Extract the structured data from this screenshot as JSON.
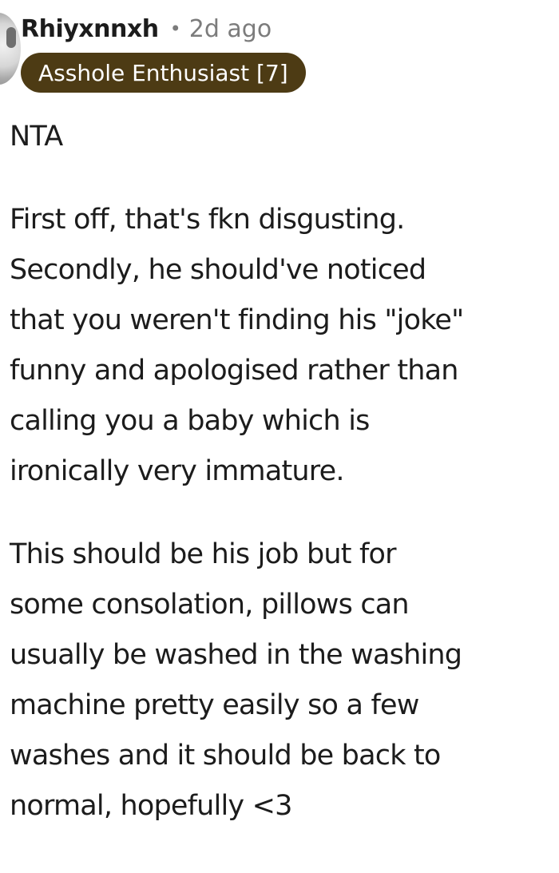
{
  "comment": {
    "author": "Rhiyxnnxh",
    "separator": "•",
    "timestamp": "2d ago",
    "flair": "Asshole Enthusiast [7]",
    "paragraphs": [
      {
        "lines": [
          "NTA"
        ]
      },
      {
        "lines": [
          "First off, that's fkn disgusting.",
          "Secondly, he should've noticed",
          "that you weren't finding his \"joke\"",
          "funny and apologised rather than",
          "calling you a baby which is",
          "ironically very immature."
        ]
      },
      {
        "lines": [
          "This should be his job but for",
          "some consolation, pillows can",
          "usually be washed in the washing",
          "machine pretty easily so a few",
          "washes and it should be back to",
          "normal, hopefully <3"
        ]
      }
    ]
  },
  "colors": {
    "text": "#1c1c1c",
    "meta": "#7c7c7c",
    "flair_bg": "#4d3b14",
    "flair_text": "#ffffff"
  },
  "icons": {
    "avatar": "user-avatar"
  }
}
